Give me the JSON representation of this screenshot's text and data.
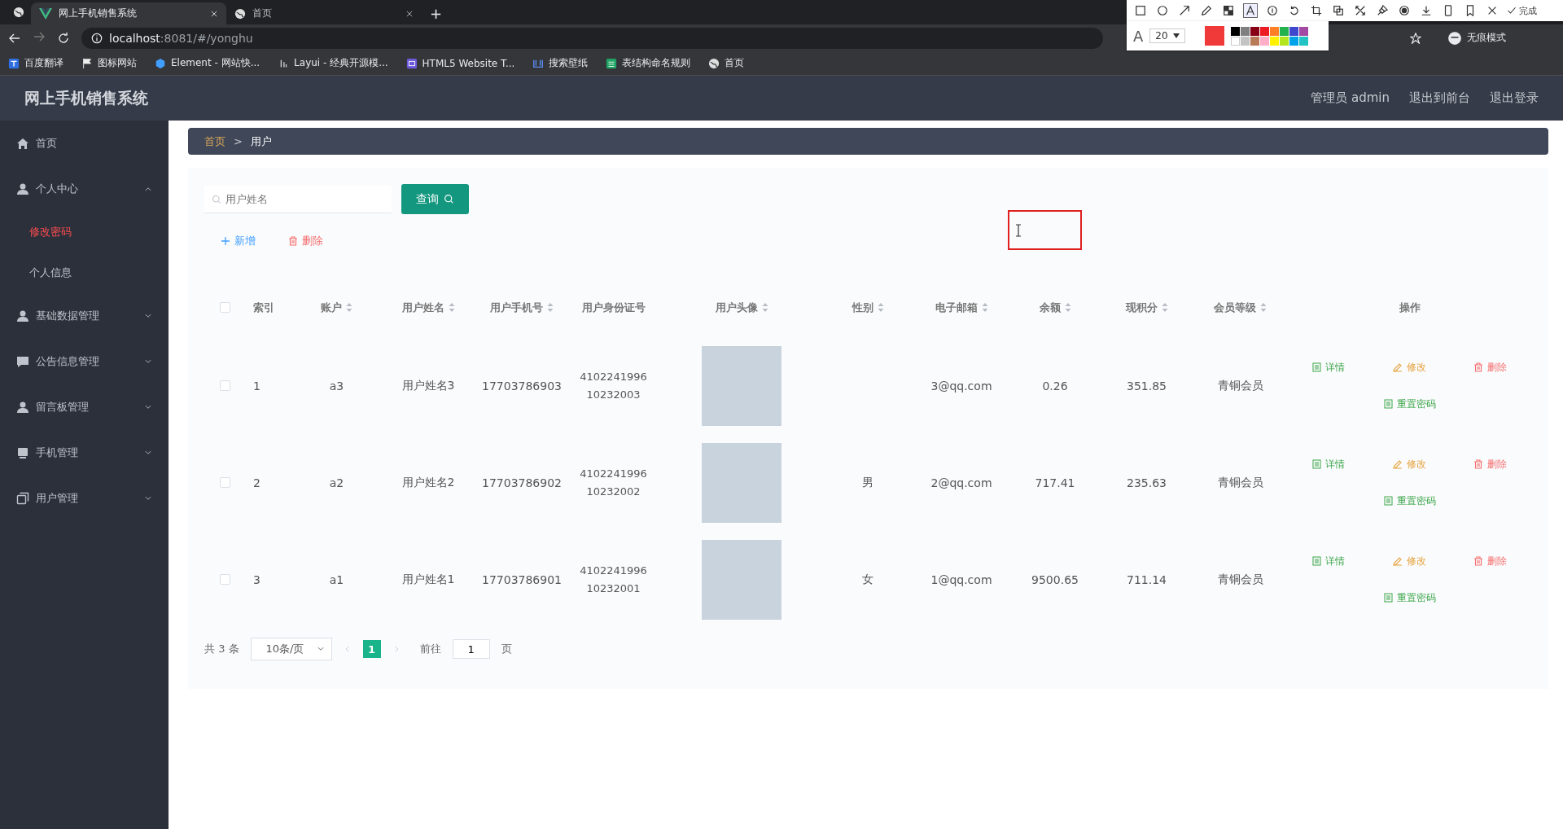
{
  "browser": {
    "tabs": [
      {
        "title": "网上手机销售系统",
        "selected": true,
        "kind": "vue"
      },
      {
        "title": "首页",
        "selected": false,
        "kind": "globe"
      }
    ],
    "new_tab": "+",
    "address": {
      "host": "localhost",
      "path": ":8081/#/yonghu"
    },
    "incognito": "无痕模式",
    "bookmarks": [
      {
        "label": "百度翻译",
        "kind": "translate"
      },
      {
        "label": "图标网站",
        "kind": "flag"
      },
      {
        "label": "Element - 网站快...",
        "kind": "element"
      },
      {
        "label": "Layui - 经典开源模...",
        "kind": "layui"
      },
      {
        "label": "HTML5 Website T...",
        "kind": "html"
      },
      {
        "label": "搜索壁纸",
        "kind": "wallpaper"
      },
      {
        "label": "表结构命名规则",
        "kind": "sheet"
      },
      {
        "label": "首页",
        "kind": "globe"
      }
    ]
  },
  "capture_toolbar": {
    "tools": [
      {
        "kind": "rect",
        "selected": false
      },
      {
        "kind": "circle",
        "selected": false
      },
      {
        "kind": "arrow",
        "selected": false
      },
      {
        "kind": "pencil",
        "selected": false
      },
      {
        "kind": "mosaic",
        "selected": false
      },
      {
        "kind": "text",
        "selected": true
      },
      {
        "kind": "counter",
        "selected": false
      },
      {
        "kind": "undo",
        "selected": false
      },
      {
        "kind": "crop",
        "selected": false
      },
      {
        "kind": "copy",
        "selected": false
      },
      {
        "kind": "scale",
        "selected": false
      },
      {
        "kind": "pin",
        "selected": false
      },
      {
        "kind": "record",
        "selected": false
      },
      {
        "kind": "download",
        "selected": false
      },
      {
        "kind": "phone",
        "selected": false
      },
      {
        "kind": "bookmark",
        "selected": false
      },
      {
        "kind": "close",
        "selected": false
      }
    ],
    "done": "完成",
    "text_label": "A",
    "font_size": "20",
    "current": {
      "color": "#f03a3a"
    },
    "palette": [
      {
        "color": "#000000"
      },
      {
        "color": "#7f7f7f"
      },
      {
        "color": "#880015"
      },
      {
        "color": "#ed1c24"
      },
      {
        "color": "#ff7f27"
      },
      {
        "color": "#22b14c"
      },
      {
        "color": "#3f48cc"
      },
      {
        "color": "#a349a4"
      },
      {
        "color": "#ffffff"
      },
      {
        "color": "#c3c3c3"
      },
      {
        "color": "#b97a57"
      },
      {
        "color": "#ffaec9"
      },
      {
        "color": "#fff200"
      },
      {
        "color": "#b5e61d"
      },
      {
        "color": "#00a2e8"
      },
      {
        "color": "#21c3c3"
      }
    ]
  },
  "header": {
    "title": "网上手机销售系统",
    "links": [
      "管理员 admin",
      "退出到前台",
      "退出登录"
    ]
  },
  "sidebar": {
    "items": [
      {
        "label": "首页",
        "kind": "home"
      },
      {
        "label": "个人中心",
        "kind": "user",
        "expanded": true,
        "children": [
          {
            "label": "修改密码",
            "selected": true
          },
          {
            "label": "个人信息",
            "selected": false
          }
        ]
      },
      {
        "label": "基础数据管理",
        "kind": "user",
        "expanded": false
      },
      {
        "label": "公告信息管理",
        "kind": "chat",
        "expanded": false
      },
      {
        "label": "留言板管理",
        "kind": "user",
        "expanded": false
      },
      {
        "label": "手机管理",
        "kind": "device",
        "expanded": false
      },
      {
        "label": "用户管理",
        "kind": "copy",
        "expanded": false
      }
    ]
  },
  "breadcrumb": {
    "items": [
      "首页",
      "用户"
    ],
    "separator": ">"
  },
  "search": {
    "placeholder": "用户姓名",
    "button": "查询"
  },
  "actions": [
    {
      "label": "新增",
      "kind": "add"
    },
    {
      "label": "删除",
      "kind": "delete"
    }
  ],
  "table": {
    "all_checked": false,
    "columns": [
      {
        "label": "索引",
        "sortable": false
      },
      {
        "label": "账户",
        "sortable": true
      },
      {
        "label": "用户姓名",
        "sortable": true
      },
      {
        "label": "用户手机号",
        "sortable": true
      },
      {
        "label": "用户身份证号",
        "sortable": false
      },
      {
        "label": "用户头像",
        "sortable": true
      },
      {
        "label": "性别",
        "sortable": true
      },
      {
        "label": "电子邮箱",
        "sortable": true
      },
      {
        "label": "余额",
        "sortable": true
      },
      {
        "label": "现积分",
        "sortable": true
      },
      {
        "label": "会员等级",
        "sortable": true
      },
      {
        "label": "操作",
        "sortable": false
      }
    ],
    "rows": [
      {
        "checked": false,
        "index": "1",
        "account": "a3",
        "name": "用户姓名3",
        "phone": "17703786903",
        "id_number": "410224199610232003",
        "email": "3@qq.com",
        "balance": "0.26",
        "points": "351.85",
        "level": "青铜会员",
        "actions": [
          {
            "label": "详情",
            "kind": "detail"
          },
          {
            "label": "修改",
            "kind": "edit"
          },
          {
            "label": "删除",
            "kind": "delete"
          },
          {
            "label": "重置密码",
            "kind": "reset"
          }
        ]
      },
      {
        "checked": false,
        "index": "2",
        "account": "a2",
        "name": "用户姓名2",
        "phone": "17703786902",
        "id_number": "410224199610232002",
        "gender": "男",
        "email": "2@qq.com",
        "balance": "717.41",
        "points": "235.63",
        "level": "青铜会员",
        "actions": [
          {
            "label": "详情",
            "kind": "detail"
          },
          {
            "label": "修改",
            "kind": "edit"
          },
          {
            "label": "删除",
            "kind": "delete"
          },
          {
            "label": "重置密码",
            "kind": "reset"
          }
        ]
      },
      {
        "checked": false,
        "index": "3",
        "account": "a1",
        "name": "用户姓名1",
        "phone": "17703786901",
        "id_number": "410224199610232001",
        "gender": "女",
        "email": "1@qq.com",
        "balance": "9500.65",
        "points": "711.14",
        "level": "青铜会员",
        "actions": [
          {
            "label": "详情",
            "kind": "detail"
          },
          {
            "label": "修改",
            "kind": "edit"
          },
          {
            "label": "删除",
            "kind": "delete"
          },
          {
            "label": "重置密码",
            "kind": "reset"
          }
        ]
      }
    ]
  },
  "pagination": {
    "total": "共 3 条",
    "page_size": "10条/页",
    "pages": [
      {
        "label": "1",
        "selected": true
      }
    ],
    "goto_label": "前往",
    "goto_value": "1",
    "goto_unit": "页"
  }
}
